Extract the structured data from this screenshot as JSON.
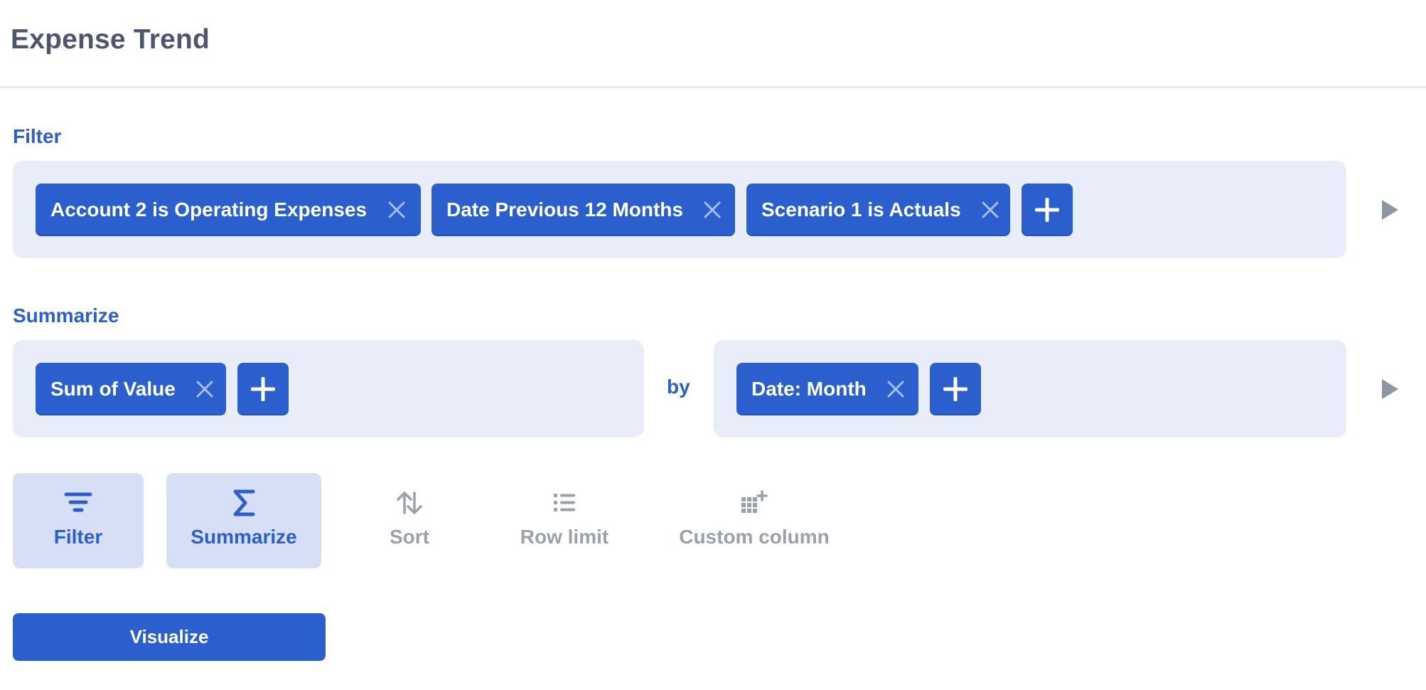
{
  "header": {
    "title": "Expense Trend"
  },
  "filter_section": {
    "label": "Filter",
    "filters": [
      {
        "label": "Account 2 is Operating Expenses"
      },
      {
        "label": "Date Previous 12 Months"
      },
      {
        "label": "Scenario 1 is Actuals"
      }
    ]
  },
  "summarize_section": {
    "label": "Summarize",
    "metrics": [
      {
        "label": "Sum of Value"
      }
    ],
    "by_label": "by",
    "groupings": [
      {
        "label": "Date: Month"
      }
    ]
  },
  "steps": [
    {
      "label": "Filter",
      "icon": "filter-icon",
      "active": true
    },
    {
      "label": "Summarize",
      "icon": "sigma-icon",
      "active": true
    },
    {
      "label": "Sort",
      "icon": "sort-arrows-icon",
      "active": false
    },
    {
      "label": "Row limit",
      "icon": "list-icon",
      "active": false
    },
    {
      "label": "Custom column",
      "icon": "grid-plus-icon",
      "active": false
    }
  ],
  "visualize_button": {
    "label": "Visualize"
  },
  "colors": {
    "accent": "#2b5fce",
    "panel_background": "#e9edf9",
    "active_step_background": "#d6dff5",
    "muted_text": "#9aa1ad",
    "title_text": "#4b5670"
  }
}
